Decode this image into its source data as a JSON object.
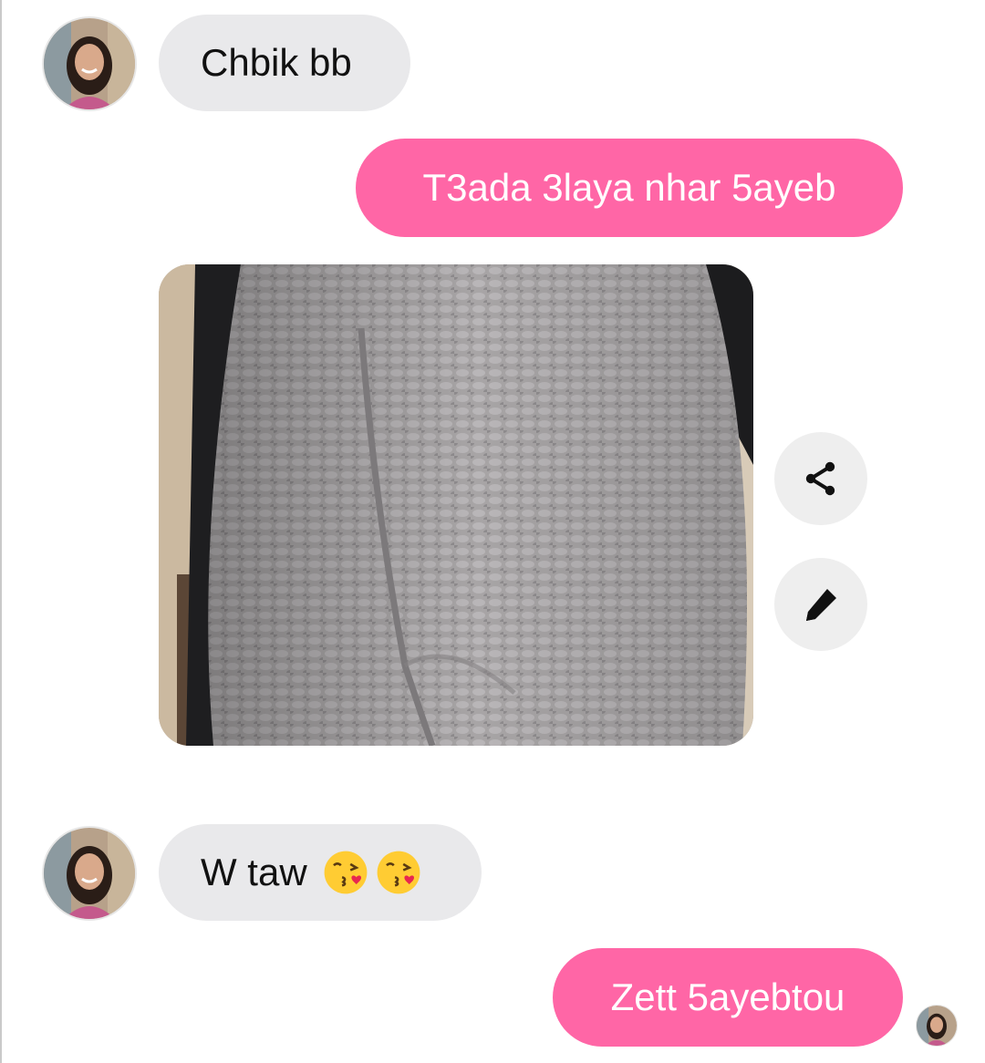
{
  "messages": [
    {
      "sender": "contact",
      "text": "Chbik bb"
    },
    {
      "sender": "me",
      "text": "T3ada 3laya nhar 5ayeb"
    },
    {
      "sender": "me",
      "attachment": "photo"
    },
    {
      "sender": "contact",
      "text": "W taw",
      "emoji": [
        "kissing-heart-emoji",
        "kissing-heart-emoji"
      ]
    },
    {
      "sender": "me",
      "text": "Zett 5ayebtou"
    }
  ],
  "photo_actions": [
    {
      "icon": "share-icon"
    },
    {
      "icon": "pencil-icon"
    }
  ],
  "colors": {
    "outgoing_bubble": "#ff66a6",
    "incoming_bubble": "#e9e9eb",
    "action_button": "#eeeeee"
  }
}
